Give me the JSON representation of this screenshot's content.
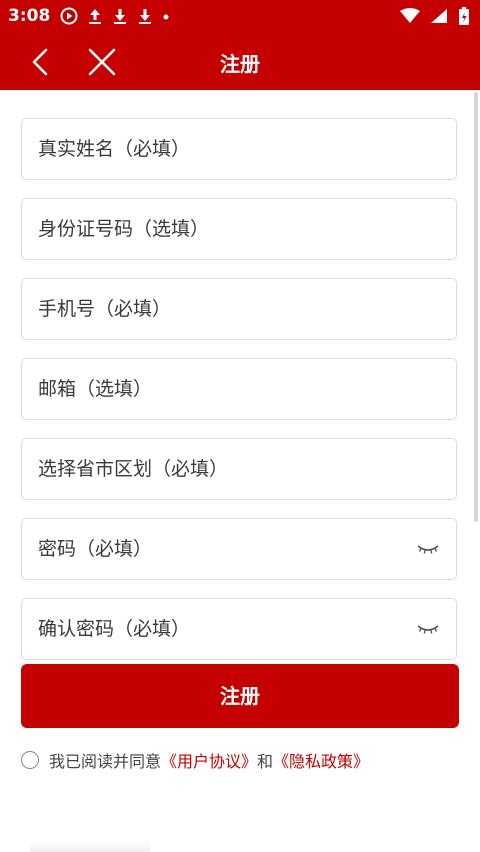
{
  "status_bar": {
    "time": "3:08",
    "icons_left": [
      "play-circle-icon",
      "upload-icon",
      "download-icon",
      "download-icon",
      "dot-icon"
    ],
    "icons_right": [
      "wifi-icon",
      "signal-icon",
      "battery-icon"
    ]
  },
  "header": {
    "title": "注册",
    "back_icon": "chevron-left-icon",
    "close_icon": "close-icon",
    "bg_color": "#c40000"
  },
  "form": {
    "fields": [
      {
        "placeholder": "真实姓名（必填）"
      },
      {
        "placeholder": "身份证号码（选填）"
      },
      {
        "placeholder": "手机号（必填）"
      },
      {
        "placeholder": "邮箱（选填）"
      },
      {
        "placeholder": "选择省市区划（必填）"
      },
      {
        "placeholder": "密码（必填）",
        "icon": "eye-closed-icon"
      },
      {
        "placeholder": "确认密码（必填）",
        "icon": "eye-closed-icon"
      }
    ],
    "submit_label": "注册"
  },
  "agreement": {
    "prefix": "我已阅读并同意",
    "user_agreement": "《用户协议》",
    "and": "和",
    "privacy_policy": "《隐私政策》"
  },
  "accent_color": "#c40000"
}
